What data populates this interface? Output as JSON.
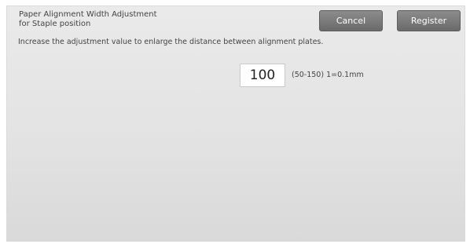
{
  "header": {
    "title_line1": "Paper Alignment Width Adjustment",
    "title_line2": "for Staple position",
    "cancel_label": "Cancel",
    "register_label": "Register"
  },
  "main": {
    "instruction": "Increase the adjustment value to enlarge the distance between alignment plates.",
    "value": "100",
    "range_info": "(50-150) 1=0.1mm"
  }
}
